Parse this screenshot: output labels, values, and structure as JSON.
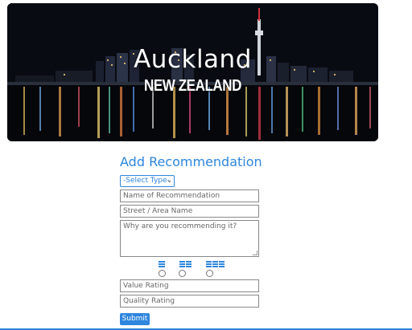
{
  "hero": {
    "title": "Auckland",
    "subtitle": "NEW ZEALAND"
  },
  "form": {
    "heading": "Add Recommendation",
    "type_select": {
      "selected": "-Select Type-"
    },
    "name_placeholder": "Name of Recommendation",
    "street_placeholder": "Street / Area Name",
    "reason_placeholder": "Why are you recommending it?",
    "price_options": [
      {
        "icon": "money-stack-icon",
        "level": 1
      },
      {
        "icon": "money-stack-icon",
        "level": 2
      },
      {
        "icon": "money-stack-icon",
        "level": 3
      }
    ],
    "value_rating_placeholder": "Value Rating",
    "quality_rating_placeholder": "Quality Rating",
    "submit_label": "Submit"
  },
  "colors": {
    "accent": "#2e86de"
  }
}
